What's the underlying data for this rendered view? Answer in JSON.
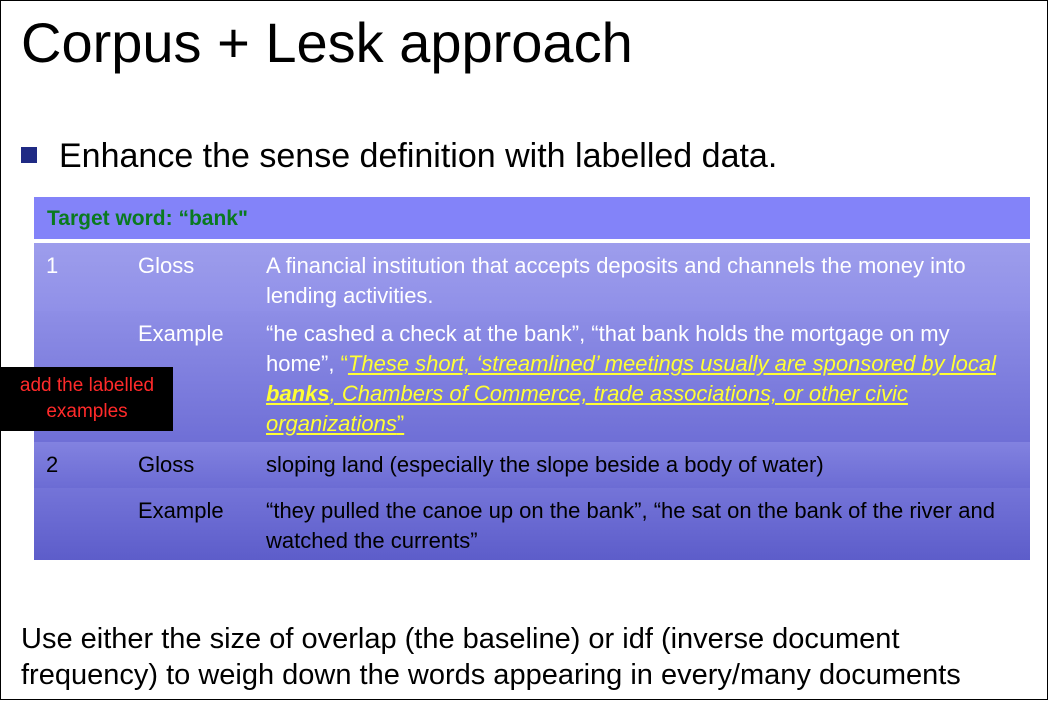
{
  "slide": {
    "title": "Corpus + Lesk approach",
    "bullet": "Enhance the sense definition with labelled data.",
    "table": {
      "header": "Target word: “bank\"",
      "rows": [
        {
          "num": "1",
          "type": "Gloss",
          "text": "A financial institution that accepts deposits and channels the money into lending activities."
        },
        {
          "num": "",
          "type": "Example",
          "text_plain": "“he cashed a check at the bank”, “that bank holds the mortgage on my home”, ",
          "quote_open": "“",
          "highlight_part1": "These short, ‘streamlined’ meetings usually are sponsored by local ",
          "highlight_bold": "banks",
          "highlight_part2": ", Chambers of Commerce, trade associations, or other civic organizations",
          "quote_close": "”"
        },
        {
          "num": "2",
          "type": "Gloss",
          "text": "sloping land (especially the slope beside a body of water)"
        },
        {
          "num": "",
          "type": "Example",
          "text": "“they pulled the canoe up on the bank”, “he sat on the bank of the river and watched the currents”"
        }
      ]
    },
    "annotation": "add the labelled examples",
    "footer": "Use either the size of overlap (the baseline) or idf (inverse document frequency) to weigh down the words appearing in every/many documents"
  }
}
